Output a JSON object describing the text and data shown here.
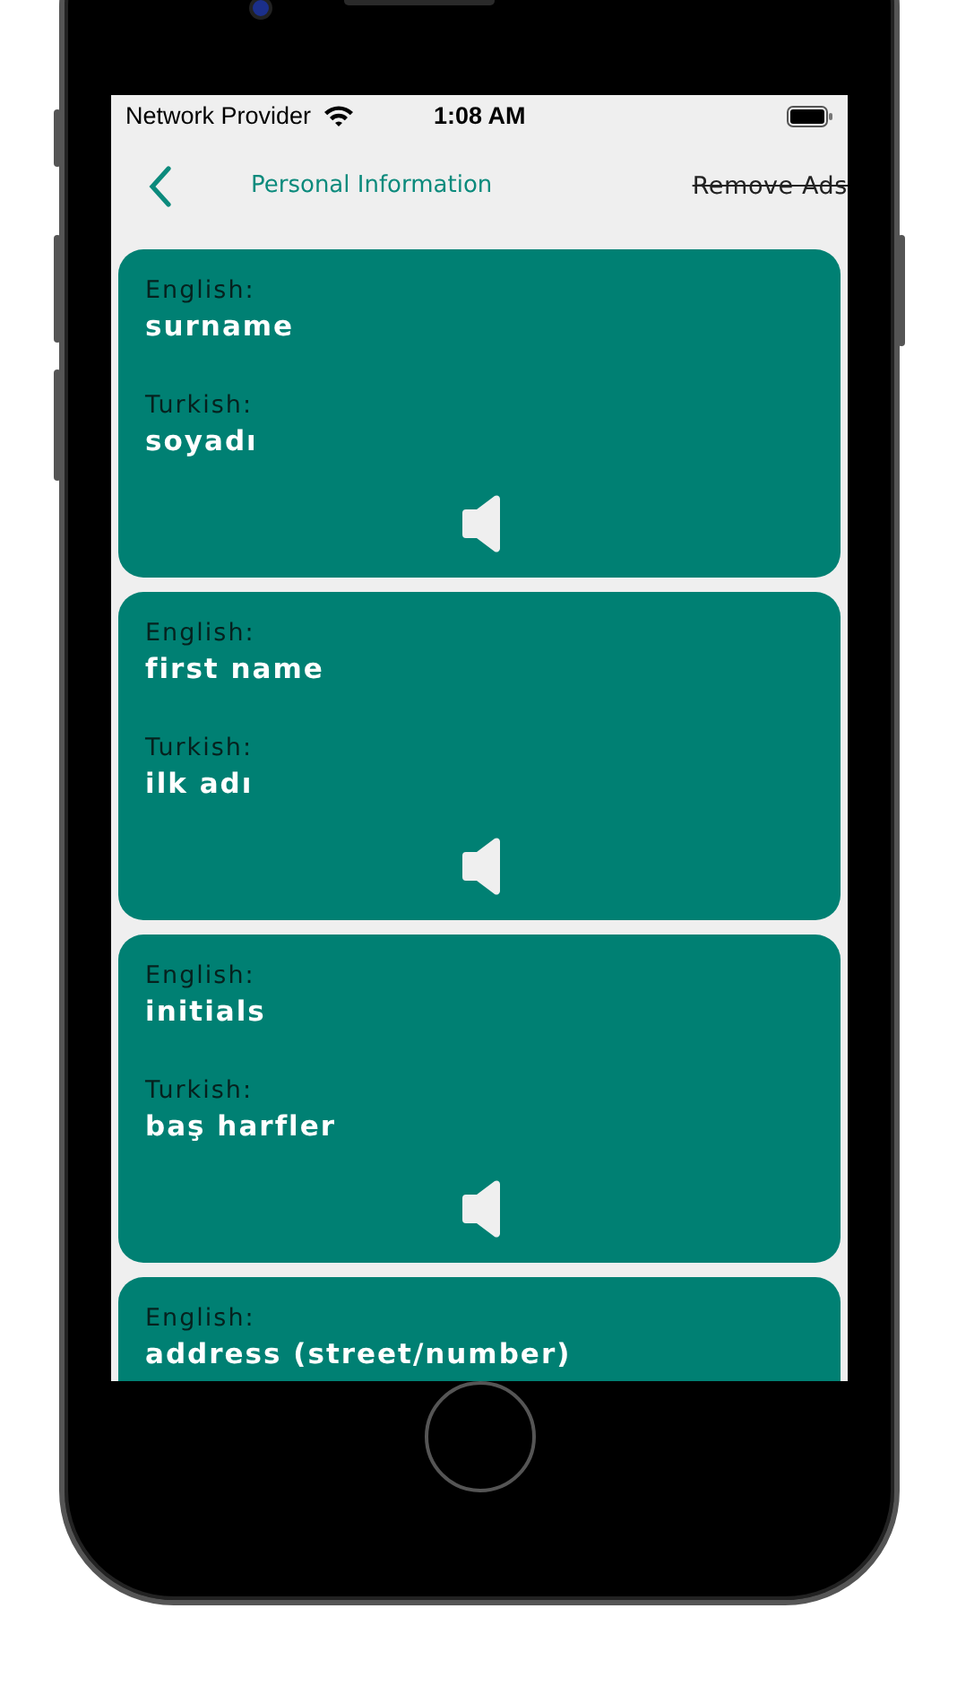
{
  "status_bar": {
    "carrier": "Network Provider",
    "time": "1:08 AM"
  },
  "header": {
    "title": "Personal Information",
    "action": {
      "label": "Remove Ads",
      "strikethrough": true
    }
  },
  "cards": [
    {
      "english_label": "English:",
      "english": "surname",
      "turkish_label": "Turkish:",
      "turkish": "soyadı"
    },
    {
      "english_label": "English:",
      "english": "first name",
      "turkish_label": "Turkish:",
      "turkish": "ilk adı"
    },
    {
      "english_label": "English:",
      "english": "initials",
      "turkish_label": "Turkish:",
      "turkish": "baş harfler"
    },
    {
      "english_label": "English:",
      "english": "address (street/number)"
    }
  ]
}
